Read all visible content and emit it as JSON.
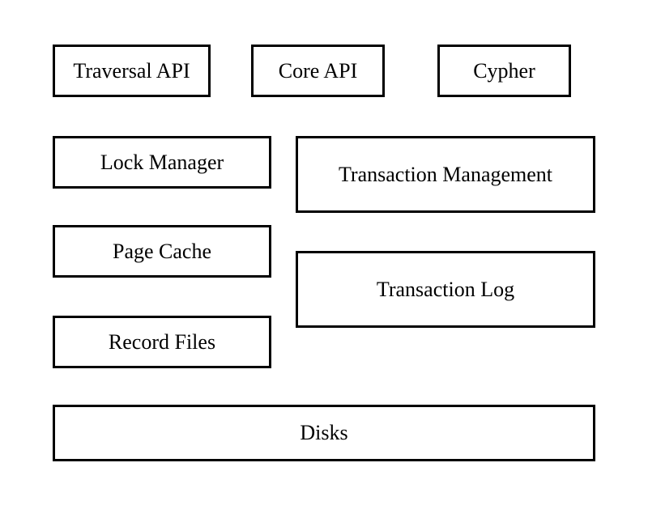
{
  "diagram": {
    "boxes": {
      "traversal_api": "Traversal API",
      "core_api": "Core API",
      "cypher": "Cypher",
      "lock_manager": "Lock Manager",
      "page_cache": "Page Cache",
      "record_files": "Record Files",
      "transaction_management": "Transaction Management",
      "transaction_log": "Transaction Log",
      "disks": "Disks"
    }
  }
}
